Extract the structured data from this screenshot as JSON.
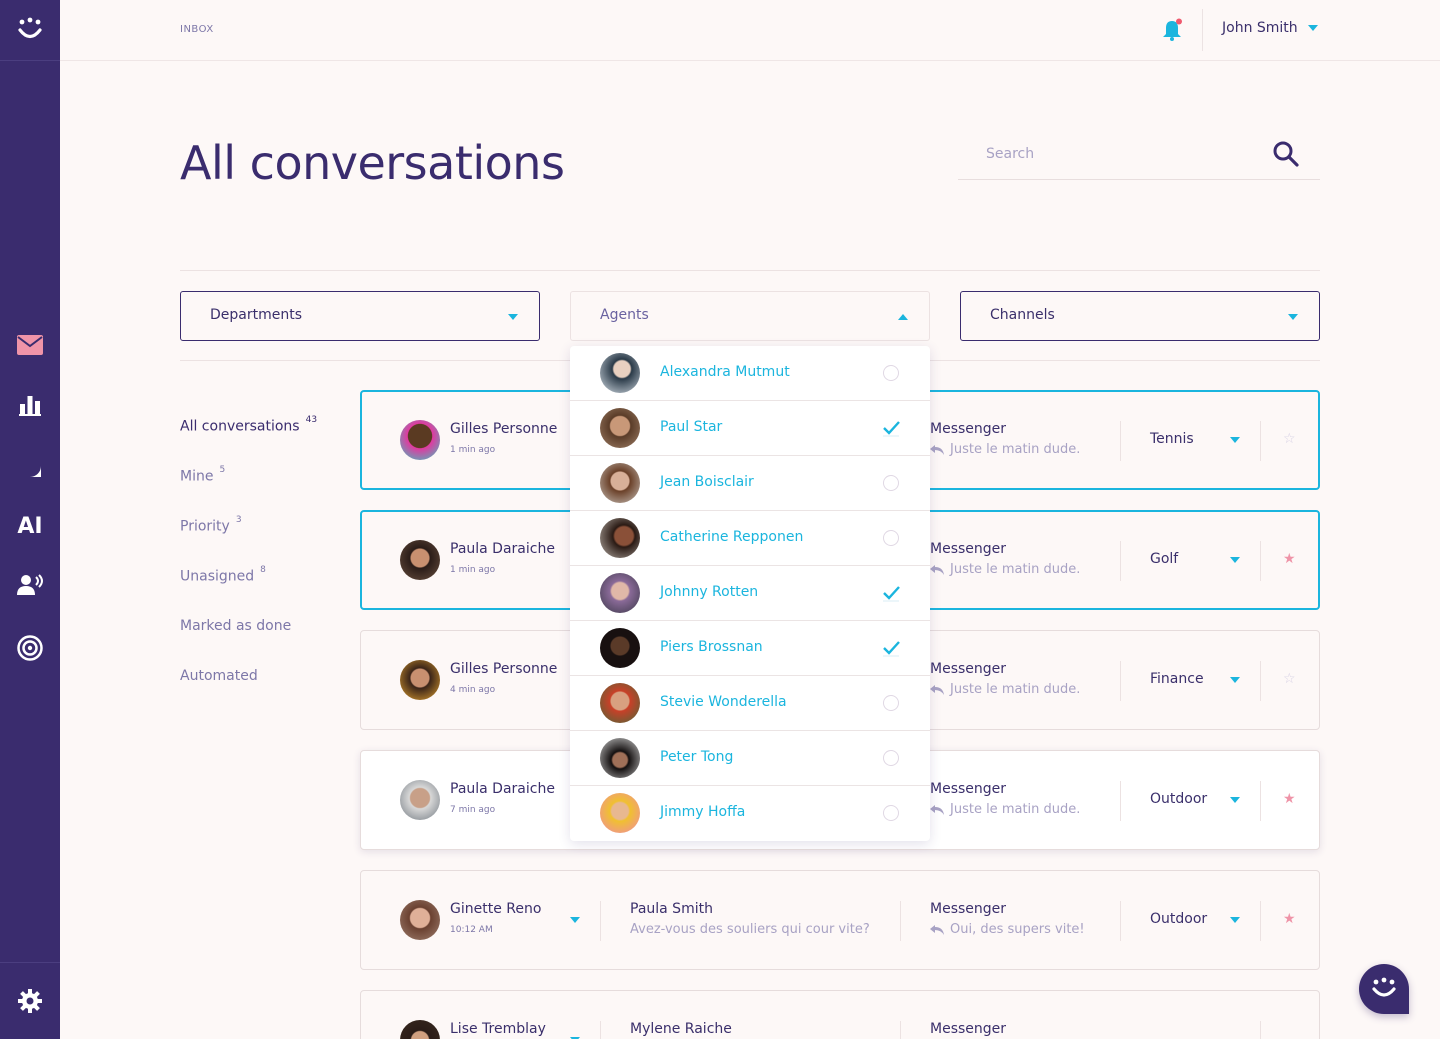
{
  "topbar": {
    "breadcrumb": "INBOX",
    "user_name": "John Smith"
  },
  "page": {
    "title": "All conversations"
  },
  "search": {
    "placeholder": "Search"
  },
  "sidebar": {
    "items": [
      {
        "icon": "mail-icon",
        "label": "Inbox"
      },
      {
        "icon": "bar-chart-icon",
        "label": "Reports"
      },
      {
        "icon": "chat-bubble-icon",
        "label": "Chat"
      },
      {
        "icon": "ai-icon",
        "label": "AI"
      },
      {
        "icon": "speaker-person-icon",
        "label": "Agents"
      },
      {
        "icon": "target-icon",
        "label": "Goals"
      }
    ],
    "ai_label": "AI",
    "settings_icon": "gear-icon"
  },
  "filters": {
    "departments": "Departments",
    "agents": "Agents",
    "channels": "Channels"
  },
  "leftnav": [
    {
      "label": "All conversations",
      "count": "43"
    },
    {
      "label": "Mine",
      "count": "5"
    },
    {
      "label": "Priority",
      "count": "3"
    },
    {
      "label": "Unasigned",
      "count": "8"
    },
    {
      "label": "Marked as done",
      "count": ""
    },
    {
      "label": "Automated",
      "count": ""
    }
  ],
  "conversations": [
    {
      "name": "Gilles Personne",
      "time": "1 min ago",
      "agent": "",
      "agent_msg": "",
      "channel": "Messenger",
      "channel_msg": "Juste le matin dude.",
      "tag": "Tennis",
      "starred": false
    },
    {
      "name": "Paula Daraiche",
      "time": "1 min ago",
      "agent": "",
      "agent_msg": "",
      "channel": "Messenger",
      "channel_msg": "Juste le matin dude.",
      "tag": "Golf",
      "starred": true
    },
    {
      "name": "Gilles Personne",
      "time": "4 min ago",
      "agent": "",
      "agent_msg": "",
      "channel": "Messenger",
      "channel_msg": "Juste le matin dude.",
      "tag": "Finance",
      "starred": false
    },
    {
      "name": "Paula Daraiche",
      "time": "7 min ago",
      "agent": "",
      "agent_msg": "",
      "channel": "Messenger",
      "channel_msg": "Juste le matin dude.",
      "tag": "Outdoor",
      "starred": true
    },
    {
      "name": "Ginette Reno",
      "time": "10:12 AM",
      "agent": "Paula Smith",
      "agent_msg": "Avez-vous des souliers qui cour vite?",
      "channel": "Messenger",
      "channel_msg": "Oui, des supers vite!",
      "tag": "Outdoor",
      "starred": true
    },
    {
      "name": "Lise Tremblay",
      "time": "",
      "agent": "Mylene Raiche",
      "agent_msg": "",
      "channel": "Messenger",
      "channel_msg": "",
      "tag": "",
      "starred": false
    }
  ],
  "agents_dropdown": [
    {
      "name": "Alexandra Mutmut",
      "checked": false
    },
    {
      "name": "Paul Star",
      "checked": true
    },
    {
      "name": "Jean Boisclair",
      "checked": false
    },
    {
      "name": "Catherine Repponen",
      "checked": false
    },
    {
      "name": "Johnny Rotten",
      "checked": true
    },
    {
      "name": "Piers Brossnan",
      "checked": true
    },
    {
      "name": "Stevie Wonderella",
      "checked": false
    },
    {
      "name": "Peter Tong",
      "checked": false
    },
    {
      "name": "Jimmy Hoffa",
      "checked": false
    }
  ],
  "colors": {
    "brand": "#3a2c6e",
    "accent": "#1bb5de",
    "star": "#ef94a8",
    "background": "#fdf8f7"
  }
}
